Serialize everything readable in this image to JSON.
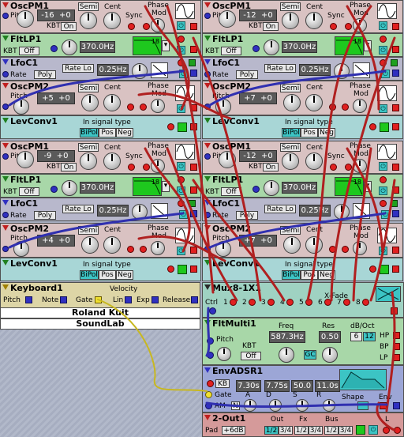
{
  "osc_top_left": {
    "title": "OscPM1",
    "pitch": "Pitch",
    "coarse": "-16",
    "fine": "+0",
    "semi": "Semi",
    "cent": "Cent",
    "kbt": "KBT",
    "on": "On",
    "sync": "Sync",
    "phase": "Phase",
    "mod": "Mod"
  },
  "osc_top_right": {
    "title": "OscPM1",
    "pitch": "Pitch",
    "coarse": "-12",
    "fine": "+0",
    "semi": "Semi",
    "cent": "Cent",
    "kbt": "KBT",
    "on": "On",
    "sync": "Sync",
    "phase": "Phase",
    "mod": "Mod"
  },
  "flt_l1": {
    "title": "FltLP1",
    "kbt": "KBT",
    "off": "Off",
    "freq": "370.0Hz",
    "slope": "18"
  },
  "flt_r1": {
    "title": "FltLP1",
    "kbt": "KBT",
    "off": "Off",
    "freq": "370.0Hz",
    "slope": "18"
  },
  "lfo_l1": {
    "title": "LfoC1",
    "rate": "Rate",
    "poly": "Poly",
    "ratelo": "Rate Lo",
    "val": "0.25Hz"
  },
  "lfo_r1": {
    "title": "LfoC1",
    "rate": "Rate",
    "poly": "Poly",
    "ratelo": "Rate Lo",
    "val": "0.25Hz"
  },
  "osc2_l1": {
    "title": "OscPM2",
    "pitch": "Pitch",
    "coarse": "+5",
    "fine": "+0",
    "semi": "Semi",
    "cent": "Cent",
    "phase": "Phase",
    "mod": "Mod"
  },
  "osc2_r1": {
    "title": "OscPM2",
    "pitch": "Pitch",
    "coarse": "+7",
    "fine": "+0",
    "semi": "Semi",
    "cent": "Cent",
    "phase": "Phase",
    "mod": "Mod"
  },
  "lev_l1": {
    "title": "LevConv1",
    "in": "In signal type",
    "bipol": "BiPol",
    "pos": "Pos",
    "neg": "Neg"
  },
  "lev_r1": {
    "title": "LevConv1",
    "in": "In signal type",
    "bipol": "BiPol",
    "pos": "Pos",
    "neg": "Neg"
  },
  "osc_l2": {
    "title": "OscPM1",
    "pitch": "Pitch",
    "coarse": "-9",
    "fine": "+0",
    "semi": "Semi",
    "cent": "Cent",
    "kbt": "KBT",
    "on": "On",
    "sync": "Sync",
    "phase": "Phase",
    "mod": "Mod"
  },
  "osc_r2": {
    "title": "OscPM1",
    "pitch": "Pitch",
    "coarse": "-12",
    "fine": "+0",
    "semi": "Semi",
    "cent": "Cent",
    "kbt": "KBT",
    "on": "On",
    "sync": "Sync",
    "phase": "Phase",
    "mod": "Mod"
  },
  "flt_l2": {
    "title": "FltLP1",
    "kbt": "KBT",
    "off": "Off",
    "freq": "370.0Hz",
    "slope": "18"
  },
  "flt_r2": {
    "title": "FltLP1",
    "kbt": "KBT",
    "off": "Off",
    "freq": "370.0Hz",
    "slope": "18"
  },
  "lfo_l2": {
    "title": "LfoC1",
    "rate": "Rate",
    "poly": "Poly",
    "ratelo": "Rate Lo",
    "val": "0.25Hz"
  },
  "lfo_r2": {
    "title": "LfoC1",
    "rate": "Rate",
    "poly": "Poly",
    "ratelo": "Rate Lo",
    "val": "0.25Hz"
  },
  "osc2_l2": {
    "title": "OscPM2",
    "pitch": "Pitch",
    "coarse": "+4",
    "fine": "+0",
    "semi": "Semi",
    "cent": "Cent",
    "phase": "Phase",
    "mod": "Mod"
  },
  "osc2_r2": {
    "title": "OscPM2",
    "pitch": "Pitch",
    "coarse": "+7",
    "fine": "+0",
    "semi": "Semi",
    "cent": "Cent",
    "phase": "Phase",
    "mod": "Mod"
  },
  "lev_l2": {
    "title": "LevConv1",
    "in": "In signal type",
    "bipol": "BiPol",
    "pos": "Pos",
    "neg": "Neg"
  },
  "lev_r2": {
    "title": "LevConv1",
    "in": "In signal type",
    "bipol": "BiPol",
    "pos": "Pos",
    "neg": "Neg"
  },
  "keyboard": {
    "title": "Keyboard1",
    "velocity": "Velocity",
    "pitch": "Pitch",
    "note": "Note",
    "gate": "Gate",
    "lin": "Lin",
    "exp": "Exp",
    "release": "Release"
  },
  "credits": {
    "author": "Roland Kuit",
    "app": "SoundLab"
  },
  "mux": {
    "title": "Mux8-1X1",
    "xfade": "X-Fade",
    "ctrl": "Ctrl",
    "inputs": [
      "1",
      "2",
      "3",
      "4",
      "5",
      "6",
      "7",
      "8"
    ]
  },
  "fltmulti": {
    "title": "FltMulti1",
    "freq": "Freq",
    "freq_val": "587.3Hz",
    "res": "Res",
    "res_val": "0.50",
    "db": "dB/Oct",
    "db6": "6",
    "db12": "12",
    "pitch": "Pitch",
    "kbt": "KBT",
    "off": "Off",
    "gc": "GC",
    "hp": "HP",
    "bp": "BP",
    "lp": "LP"
  },
  "env": {
    "title": "EnvADSR1",
    "kb": "KB",
    "a": "7.30s",
    "d": "7.75s",
    "s": "50.0",
    "r": "11.0s",
    "gate": "Gate",
    "am": "AM",
    "n": "N",
    "la": "A",
    "ld": "D",
    "ls": "S",
    "lr": "R",
    "shape": "Shape",
    "envl": "Env"
  },
  "out": {
    "title": "2-Out1",
    "pad": "Pad",
    "db": "+6dB",
    "out": "Out",
    "fx": "Fx",
    "bus": "Bus",
    "o1": "1/2",
    "o2": "3/4",
    "f1": "1/2",
    "f2": "3/4",
    "b1": "1/2",
    "b2": "3/4",
    "l": "L"
  }
}
